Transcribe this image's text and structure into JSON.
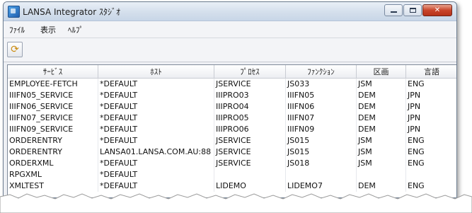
{
  "window": {
    "title": "LANSA Integrator ｽﾀｼﾞｵ"
  },
  "menubar": {
    "items": [
      "ﾌｧｲﾙ",
      "表示",
      "ﾍﾙﾌﾟ"
    ]
  },
  "table": {
    "headers": [
      "ｻｰﾋﾞｽ",
      "ﾎｽﾄ",
      "ﾌﾟﾛｾｽ",
      "ﾌｧﾝｸｼｮﾝ",
      "区画",
      "言語"
    ],
    "rows": [
      [
        "EMPLOYEE-FETCH",
        "*DEFAULT",
        "JSERVICE",
        "JS033",
        "JSM",
        "ENG"
      ],
      [
        "IIIFN05_SERVICE",
        "*DEFAULT",
        "IIIPRO03",
        "IIIFN05",
        "DEM",
        "JPN"
      ],
      [
        "IIIFN06_SERVICE",
        "*DEFAULT",
        "IIIPRO04",
        "IIIFN06",
        "DEM",
        "JPN"
      ],
      [
        "IIIFN07_SERVICE",
        "*DEFAULT",
        "IIIPRO05",
        "IIIFN07",
        "DEM",
        "JPN"
      ],
      [
        "IIIFN09_SERVICE",
        "*DEFAULT",
        "IIIPRO06",
        "IIIFN09",
        "DEM",
        "JPN"
      ],
      [
        "ORDERENTRY",
        "*DEFAULT",
        "JSERVICE",
        "JS015",
        "JSM",
        "ENG"
      ],
      [
        "ORDERENTRY",
        "LANSA01.LANSA.COM.AU:88",
        "JSERVICE",
        "JS015",
        "JSM",
        "ENG"
      ],
      [
        "ORDERXML",
        "*DEFAULT",
        "JSERVICE",
        "JS018",
        "JSM",
        "ENG"
      ],
      [
        "RPGXML",
        "*DEFAULT",
        "",
        "",
        "",
        ""
      ],
      [
        "XMLTEST",
        "*DEFAULT",
        "LIDEMO",
        "LIDEMO7",
        "DEM",
        "ENG"
      ]
    ]
  },
  "icons": {
    "app": "lansa-app-icon",
    "toolbar": "refresh-icon"
  }
}
